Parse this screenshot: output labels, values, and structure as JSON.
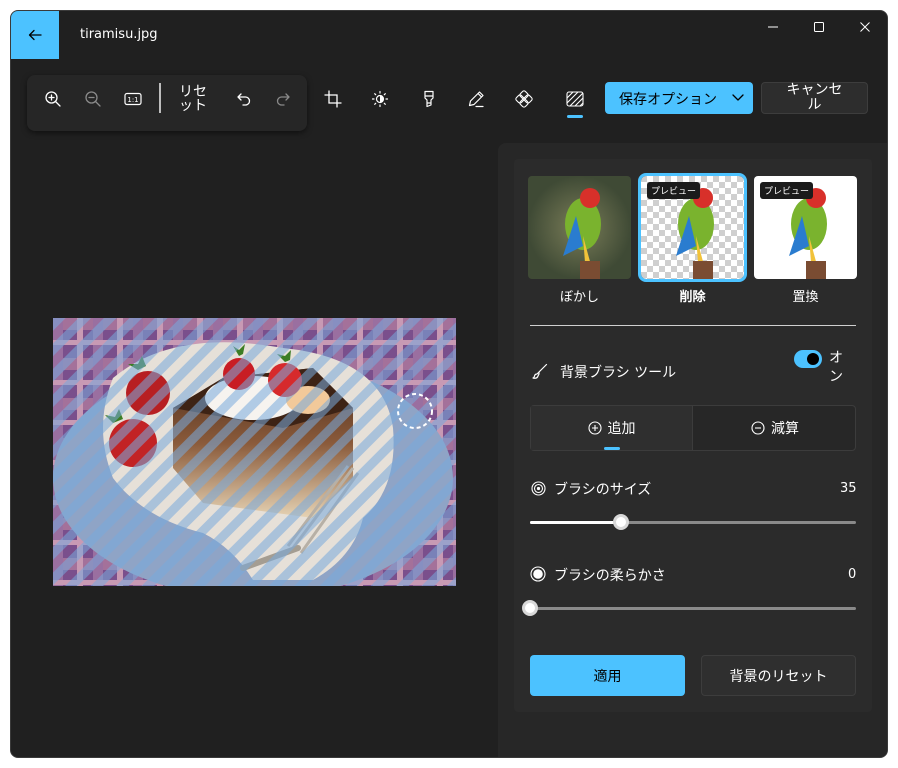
{
  "window": {
    "title": "tiramisu.jpg"
  },
  "toolbar": {
    "reset_label": "リセット",
    "save_options_label": "保存オプション",
    "cancel_label": "キャンセル"
  },
  "panel": {
    "thumbnails": [
      {
        "label": "ぼかし",
        "badge": ""
      },
      {
        "label": "削除",
        "badge": "プレビュー"
      },
      {
        "label": "置換",
        "badge": "プレビュー"
      }
    ],
    "brush_tool_label": "背景ブラシ ツール",
    "toggle_label": "オン",
    "add_label": "追加",
    "subtract_label": "減算",
    "brush_size_label": "ブラシのサイズ",
    "brush_size_value": "35",
    "brush_softness_label": "ブラシの柔らかさ",
    "brush_softness_value": "0",
    "apply_label": "適用",
    "reset_bg_label": "背景のリセット"
  },
  "sliders": {
    "brush_size_fraction": 0.28,
    "brush_softness_fraction": 0.0
  },
  "colors": {
    "accent": "#4cc2ff",
    "window_bg": "#202020",
    "panel_bg": "#2b2b2b"
  }
}
